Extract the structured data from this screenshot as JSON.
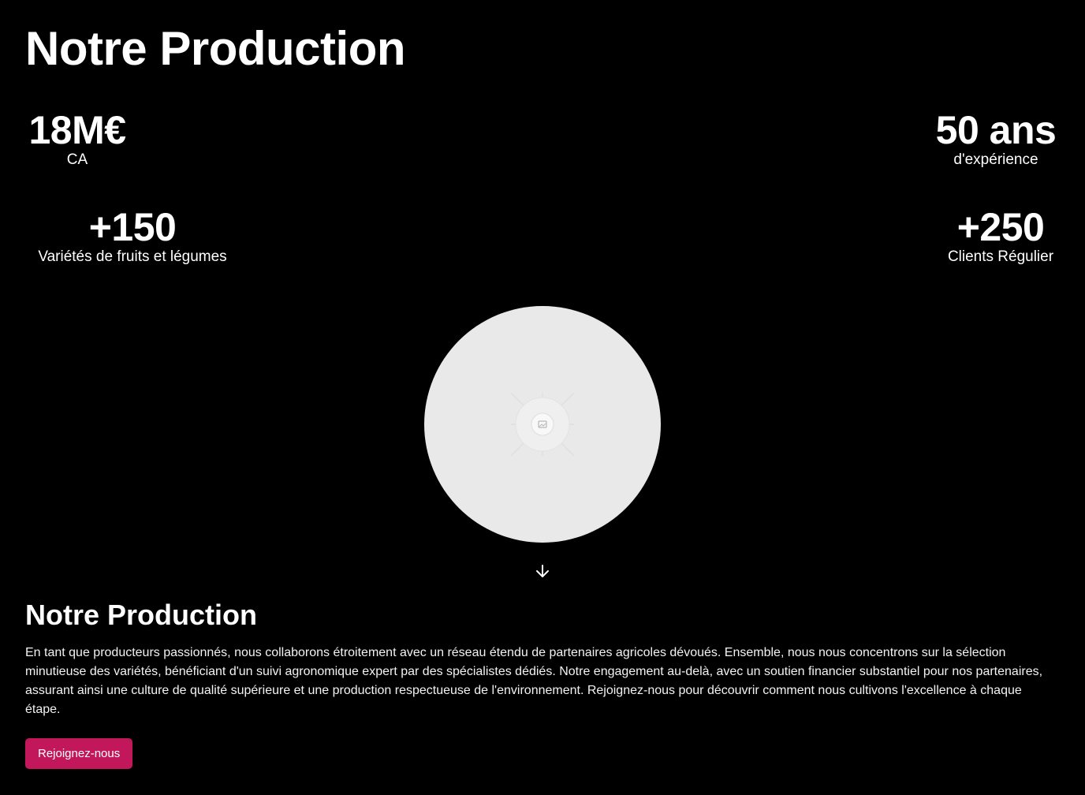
{
  "page": {
    "title": "Notre Production"
  },
  "stats": {
    "ca": {
      "value": "18M€",
      "label": "CA"
    },
    "experience": {
      "value": "50 ans",
      "label": "d'expérience"
    },
    "varieties": {
      "value": "+150",
      "label": "Variétés de fruits et légumes"
    },
    "clients": {
      "value": "+250",
      "label": "Clients Régulier"
    }
  },
  "media": {
    "image_placeholder_icon": "image-icon",
    "scroll_icon": "arrow-down-icon"
  },
  "section": {
    "title": "Notre Production",
    "text": "En tant que producteurs passionnés, nous collaborons étroitement avec un réseau étendu de partenaires agricoles dévoués. Ensemble, nous nous concentrons sur la sélection minutieuse des variétés, bénéficiant d'un suivi agronomique expert par des spécialistes dédiés. Notre engagement au-delà, avec un soutien financier substantiel pour nos partenaires, assurant ainsi une culture de qualité supérieure et une production respectueuse de l'environnement. Rejoignez-nous pour découvrir comment nous cultivons l'excellence à chaque étape.",
    "cta_label": "Rejoignez-nous"
  },
  "colors": {
    "background": "#000000",
    "text": "#ffffff",
    "accent": "#c2185b",
    "placeholder": "#e9e9e9"
  }
}
